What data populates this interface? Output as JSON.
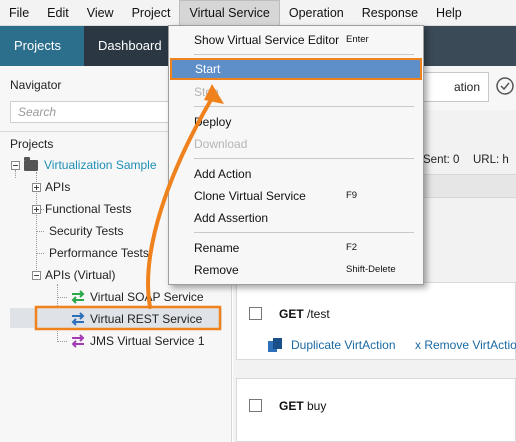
{
  "menubar": {
    "items": [
      "File",
      "Edit",
      "View",
      "Project",
      "Virtual Service",
      "Operation",
      "Response",
      "Help"
    ]
  },
  "topbar": {
    "projects_tab": "Projects",
    "dashboard_tab": "Dashboard"
  },
  "navigator": {
    "title": "Navigator",
    "search_placeholder": "Search",
    "projects_label": "Projects",
    "project_name": "Virtualization Sample",
    "items": {
      "apis": "APIs",
      "functional_tests": "Functional Tests",
      "security_tests": "Security Tests",
      "performance_tests": "Performance Tests",
      "apis_virtual": "APIs (Virtual)",
      "soap": "Virtual SOAP Service",
      "rest": "Virtual REST Service",
      "jms": "JMS Virtual Service 1"
    }
  },
  "dropdown": {
    "show_editor": "Show Virtual Service Editor",
    "show_editor_shortcut": "Enter",
    "start": "Start",
    "stop": "Stop",
    "deploy": "Deploy",
    "download": "Download",
    "add_action": "Add Action",
    "clone": "Clone Virtual Service",
    "clone_shortcut": "F9",
    "add_assertion": "Add Assertion",
    "rename": "Rename",
    "rename_shortcut": "F2",
    "remove": "Remove",
    "remove_shortcut": "Shift-Delete"
  },
  "content": {
    "action_button": "ation",
    "sent": "Sent: 0",
    "url": "URL: h",
    "card1": {
      "method": "GET",
      "path": " /test",
      "duplicate": "Duplicate VirtAction",
      "remove": "x Remove VirtAction"
    },
    "card2": {
      "method": "GET",
      "path": " buy"
    }
  },
  "colors": {
    "accent_orange": "#f0821e",
    "highlight_blue": "#5f8fc9",
    "project_teal": "#1d8fb5",
    "topbar_dark": "#3b4a57",
    "projects_tab": "#2b6f8d"
  },
  "icons": [
    "check-circle-icon",
    "folder-icon",
    "duplicate-icon",
    "soap-arrow-icon",
    "rest-arrow-icon",
    "jms-arrow-icon"
  ]
}
